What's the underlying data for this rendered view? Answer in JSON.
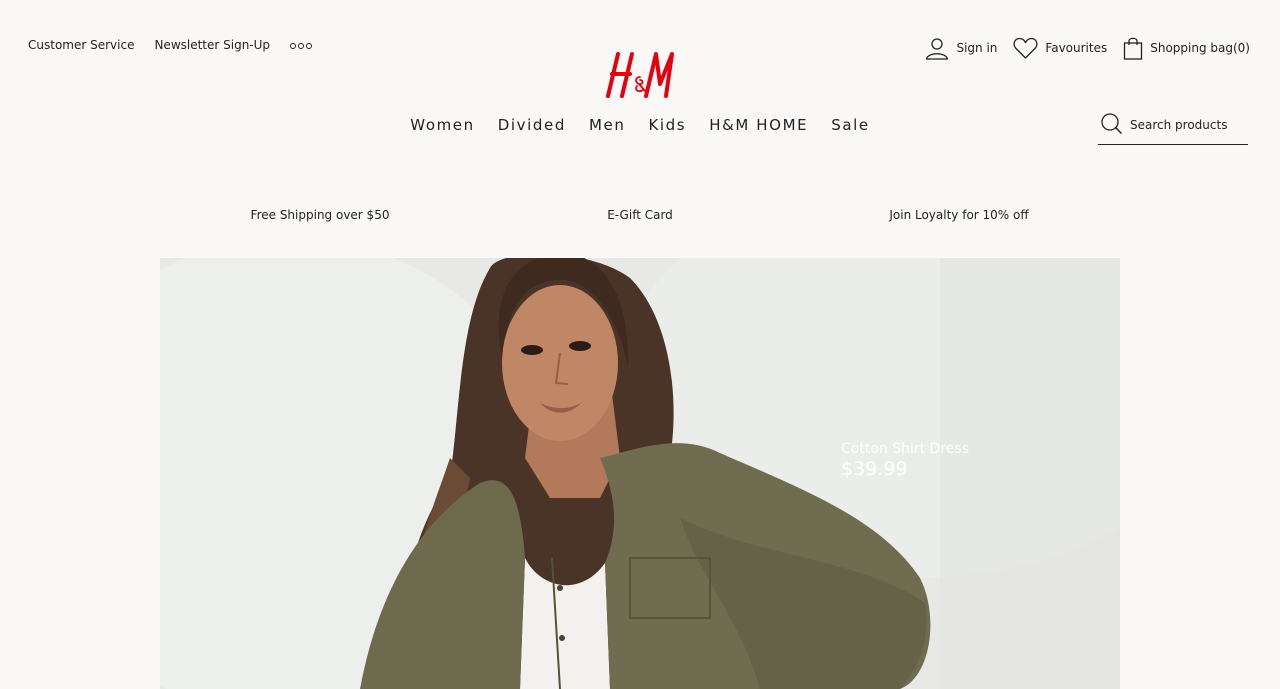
{
  "top_links": {
    "customer_service": "Customer Service",
    "newsletter": "Newsletter Sign-Up"
  },
  "logo": {
    "alt": "H&M"
  },
  "account": {
    "sign_in": "Sign in",
    "favourites": "Favourites",
    "shopping_bag": "Shopping bag(0)"
  },
  "main_nav": {
    "items": [
      "Women",
      "Divided",
      "Men",
      "Kids",
      "H&M HOME",
      "Sale"
    ]
  },
  "search": {
    "placeholder": "Search products"
  },
  "promo_bar": {
    "items": [
      "Free Shipping over $50",
      "E-Gift Card",
      "Join Loyalty for 10% off"
    ]
  },
  "hero": {
    "product_name": "Cotton Shirt Dress",
    "price": "$39.99"
  },
  "colors": {
    "brand_red": "#e50010",
    "background": "#faf9f8",
    "text": "#222222"
  },
  "icons": [
    "more-icon",
    "user-icon",
    "heart-icon",
    "bag-icon",
    "search-icon"
  ]
}
